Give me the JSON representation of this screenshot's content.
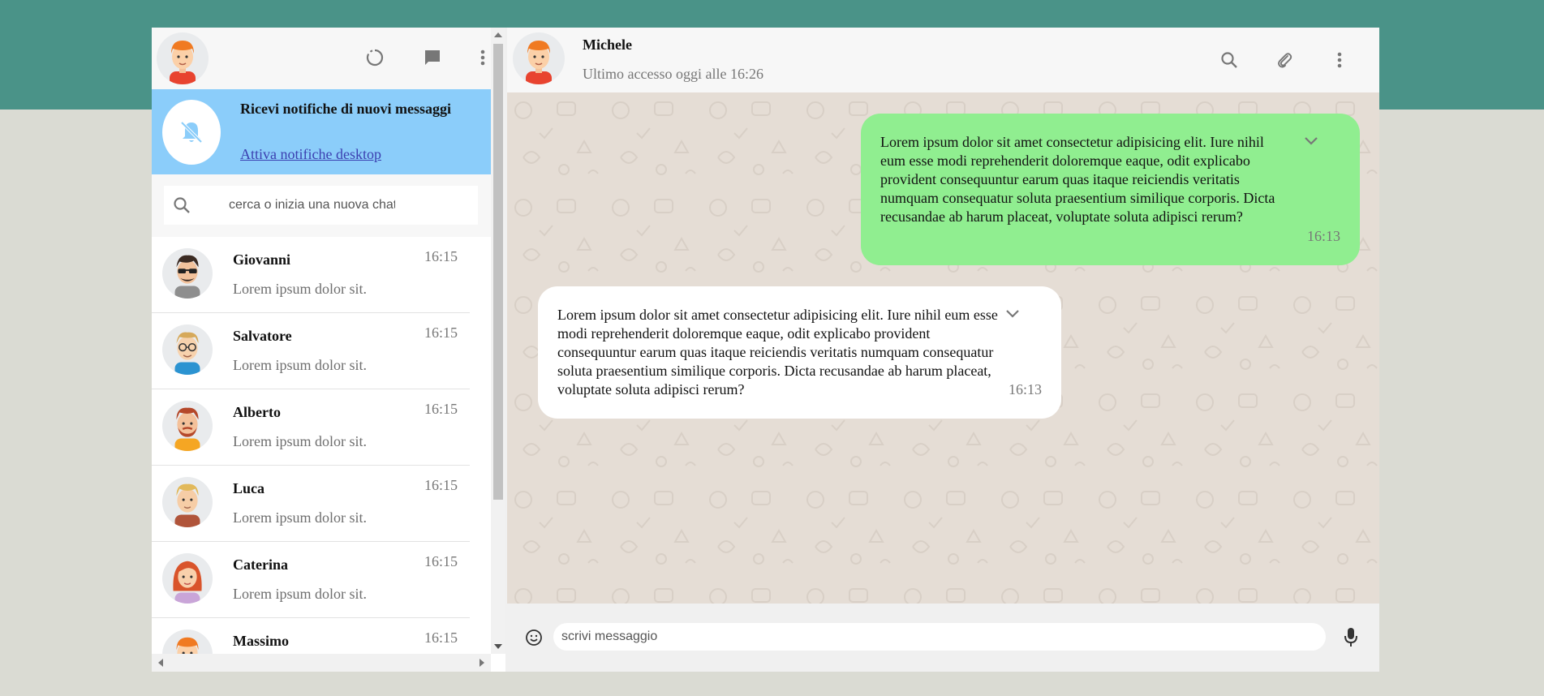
{
  "colors": {
    "accent_band": "#4a9388",
    "page_bg": "#dadbd3",
    "notification_bg": "#8bcdfa",
    "sent_bubble": "#90ee90",
    "received_bubble": "#ffffff",
    "chat_bg": "#e5ddd5"
  },
  "sidebar": {
    "header": {
      "avatar": "user-avatar-red-hair",
      "icons": [
        "status-icon",
        "chat-icon",
        "menu-icon"
      ]
    },
    "notification": {
      "icon": "bell-off-icon",
      "title": "Ricevi notifiche di nuovi messaggi",
      "link": "Attiva notifiche desktop"
    },
    "search": {
      "icon": "search-icon",
      "placeholder": "cerca o inizia una nuova chat"
    },
    "chats": [
      {
        "name": "Giovanni",
        "time": "16:15",
        "preview": "Lorem ipsum dolor sit.",
        "avatar": "avatar-sunglasses"
      },
      {
        "name": "Salvatore",
        "time": "16:15",
        "preview": "Lorem ipsum dolor sit.",
        "avatar": "avatar-glasses"
      },
      {
        "name": "Alberto",
        "time": "16:15",
        "preview": "Lorem ipsum dolor sit.",
        "avatar": "avatar-beard"
      },
      {
        "name": "Luca",
        "time": "16:15",
        "preview": "Lorem ipsum dolor sit.",
        "avatar": "avatar-blond"
      },
      {
        "name": "Caterina",
        "time": "16:15",
        "preview": "Lorem ipsum dolor sit.",
        "avatar": "avatar-woman-red-hair"
      },
      {
        "name": "Massimo",
        "time": "16:15",
        "preview": "",
        "avatar": "avatar-red-hair"
      }
    ]
  },
  "conversation": {
    "contact": {
      "name": "Michele",
      "last_seen": "Ultimo accesso oggi alle 16:26",
      "avatar": "avatar-red-hair"
    },
    "header_icons": [
      "search-icon",
      "paperclip-icon",
      "menu-icon"
    ],
    "messages": [
      {
        "direction": "sent",
        "text": "Lorem ipsum dolor sit amet consectetur adipisicing elit. Iure nihil eum esse modi reprehenderit doloremque eaque, odit explicabo provident consequuntur earum quas itaque reiciendis veritatis numquam consequatur soluta praesentium similique corporis. Dicta recusandae ab harum placeat, voluptate soluta adipisci rerum?",
        "time": "16:13"
      },
      {
        "direction": "received",
        "text": "Lorem ipsum dolor sit amet consectetur adipisicing elit. Iure nihil eum esse modi reprehenderit doloremque eaque, odit explicabo provident consequuntur earum quas itaque reiciendis veritatis numquam consequatur soluta praesentium similique corporis. Dicta recusandae ab harum placeat, voluptate soluta adipisci rerum?",
        "time": "16:13"
      }
    ],
    "composer": {
      "placeholder": "scrivi messaggio",
      "emoji_icon": "emoji-icon",
      "mic_icon": "microphone-icon"
    }
  }
}
